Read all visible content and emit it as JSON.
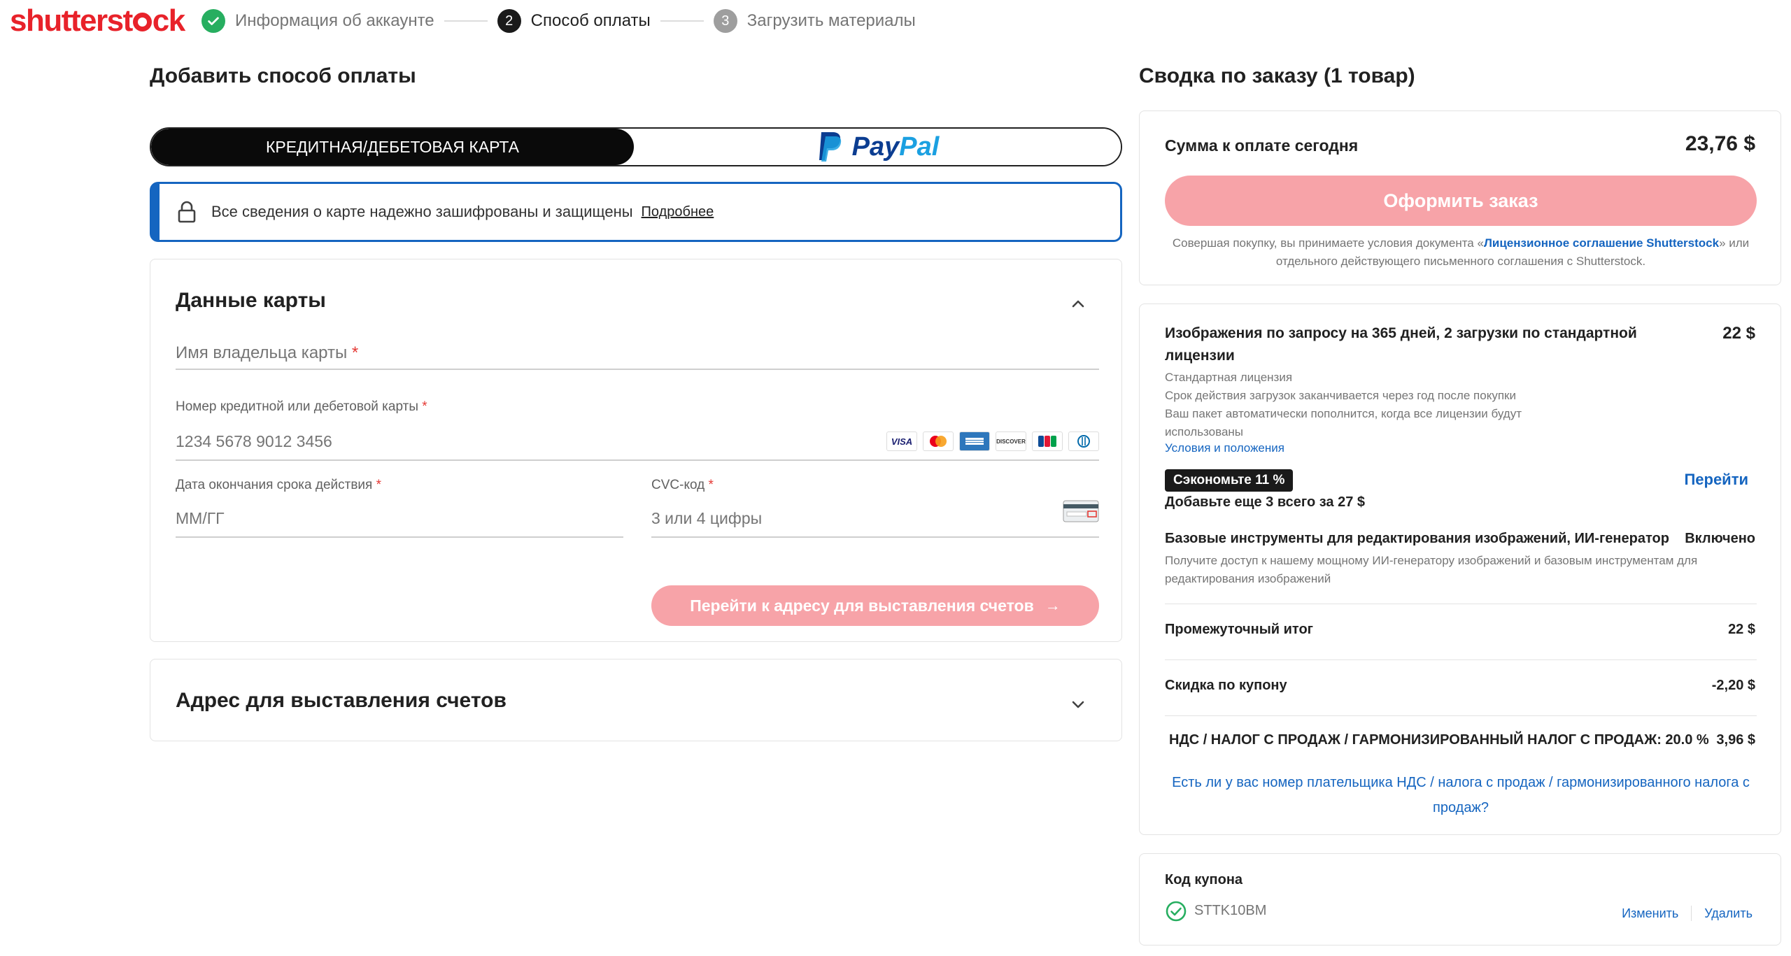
{
  "brand": {
    "logo_text_a": "shutterst",
    "logo_text_b": "ck"
  },
  "stepper": {
    "steps": [
      {
        "number": "1",
        "label": "Информация об аккаунте",
        "state": "done"
      },
      {
        "number": "2",
        "label": "Способ оплаты",
        "state": "active"
      },
      {
        "number": "3",
        "label": "Загрузить материалы",
        "state": "todo"
      }
    ]
  },
  "payment": {
    "title": "Добавить способ оплаты",
    "tab_card": "КРЕДИТНАЯ/ДЕБЕТОВАЯ КАРТА",
    "tab_paypal_a": "Pay",
    "tab_paypal_b": "Pal",
    "secure_text": "Все сведения о карте надежно зашифрованы и защищены",
    "secure_link": "Подробнее"
  },
  "card_form": {
    "title": "Данные карты",
    "holder_label": "Имя владельца карты",
    "number_label": "Номер кредитной или дебетовой карты",
    "number_placeholder": "1234 5678 9012 3456",
    "expiry_label": "Дата окончания срока действия",
    "expiry_placeholder": "ММ/ГГ",
    "cvc_label": "CVC-код",
    "cvc_placeholder": "3 или 4 цифры",
    "required_mark": "*",
    "brands": [
      "VISA",
      "MC",
      "AMEX",
      "DISCOVER",
      "JCB",
      "DINERS"
    ],
    "continue_button": "Перейти к адресу для выставления счетов"
  },
  "billing": {
    "title": "Адрес для выставления счетов"
  },
  "summary": {
    "title": "Сводка по заказу (1 товар)",
    "due_label": "Сумма к оплате сегодня",
    "due_amount": "23,76 $",
    "order_button": "Оформить заказ",
    "terms_before": "Совершая покупку, вы принимаете условия документа «",
    "terms_link": "Лицензионное соглашение Shutterstock",
    "terms_after": "» или отдельного действующего письменного соглашения с Shutterstock."
  },
  "item": {
    "title": "Изображения по запросу на 365 дней, 2 загрузки по стандартной лицензии",
    "price": "22 $",
    "license": "Стандартная лицензия",
    "expiry_note": "Срок действия загрузок заканчивается через год после покупки",
    "refill_note": "Ваш пакет автоматически пополнится, когда все лицензии будут использованы",
    "terms_link": "Условия и положения",
    "save_badge": "Сэкономьте 11 %",
    "go_link": "Перейти",
    "add_more": "Добавьте еще 3 всего за 27 $",
    "tools_title": "Базовые инструменты для редактирования изображений, ИИ-генератор",
    "tools_included": "Включено",
    "tools_desc": "Получите доступ к нашему мощному ИИ-генератору изображений и базовым инструментам для редактирования изображений"
  },
  "totals": {
    "subtotal_label": "Промежуточный итог",
    "subtotal_value": "22 $",
    "discount_label": "Скидка по купону",
    "discount_value": "-2,20 $",
    "tax_label": "НДС / НАЛОГ С ПРОДАЖ / ГАРМОНИЗИРОВАННЫЙ НАЛОГ С ПРОДАЖ: 20.0 %",
    "tax_value": "3,96 $",
    "vat_link": "Есть ли у вас номер плательщика НДС / налога с продаж / гармонизированного налога с продаж?"
  },
  "coupon": {
    "title": "Код купона",
    "code": "STTK10BM",
    "change": "Изменить",
    "remove": "Удалить"
  },
  "colors": {
    "brand_red": "#e8222a",
    "accent_blue": "#1565c0",
    "disabled_pink": "#f7a3a8",
    "success_green": "#27ae60"
  }
}
